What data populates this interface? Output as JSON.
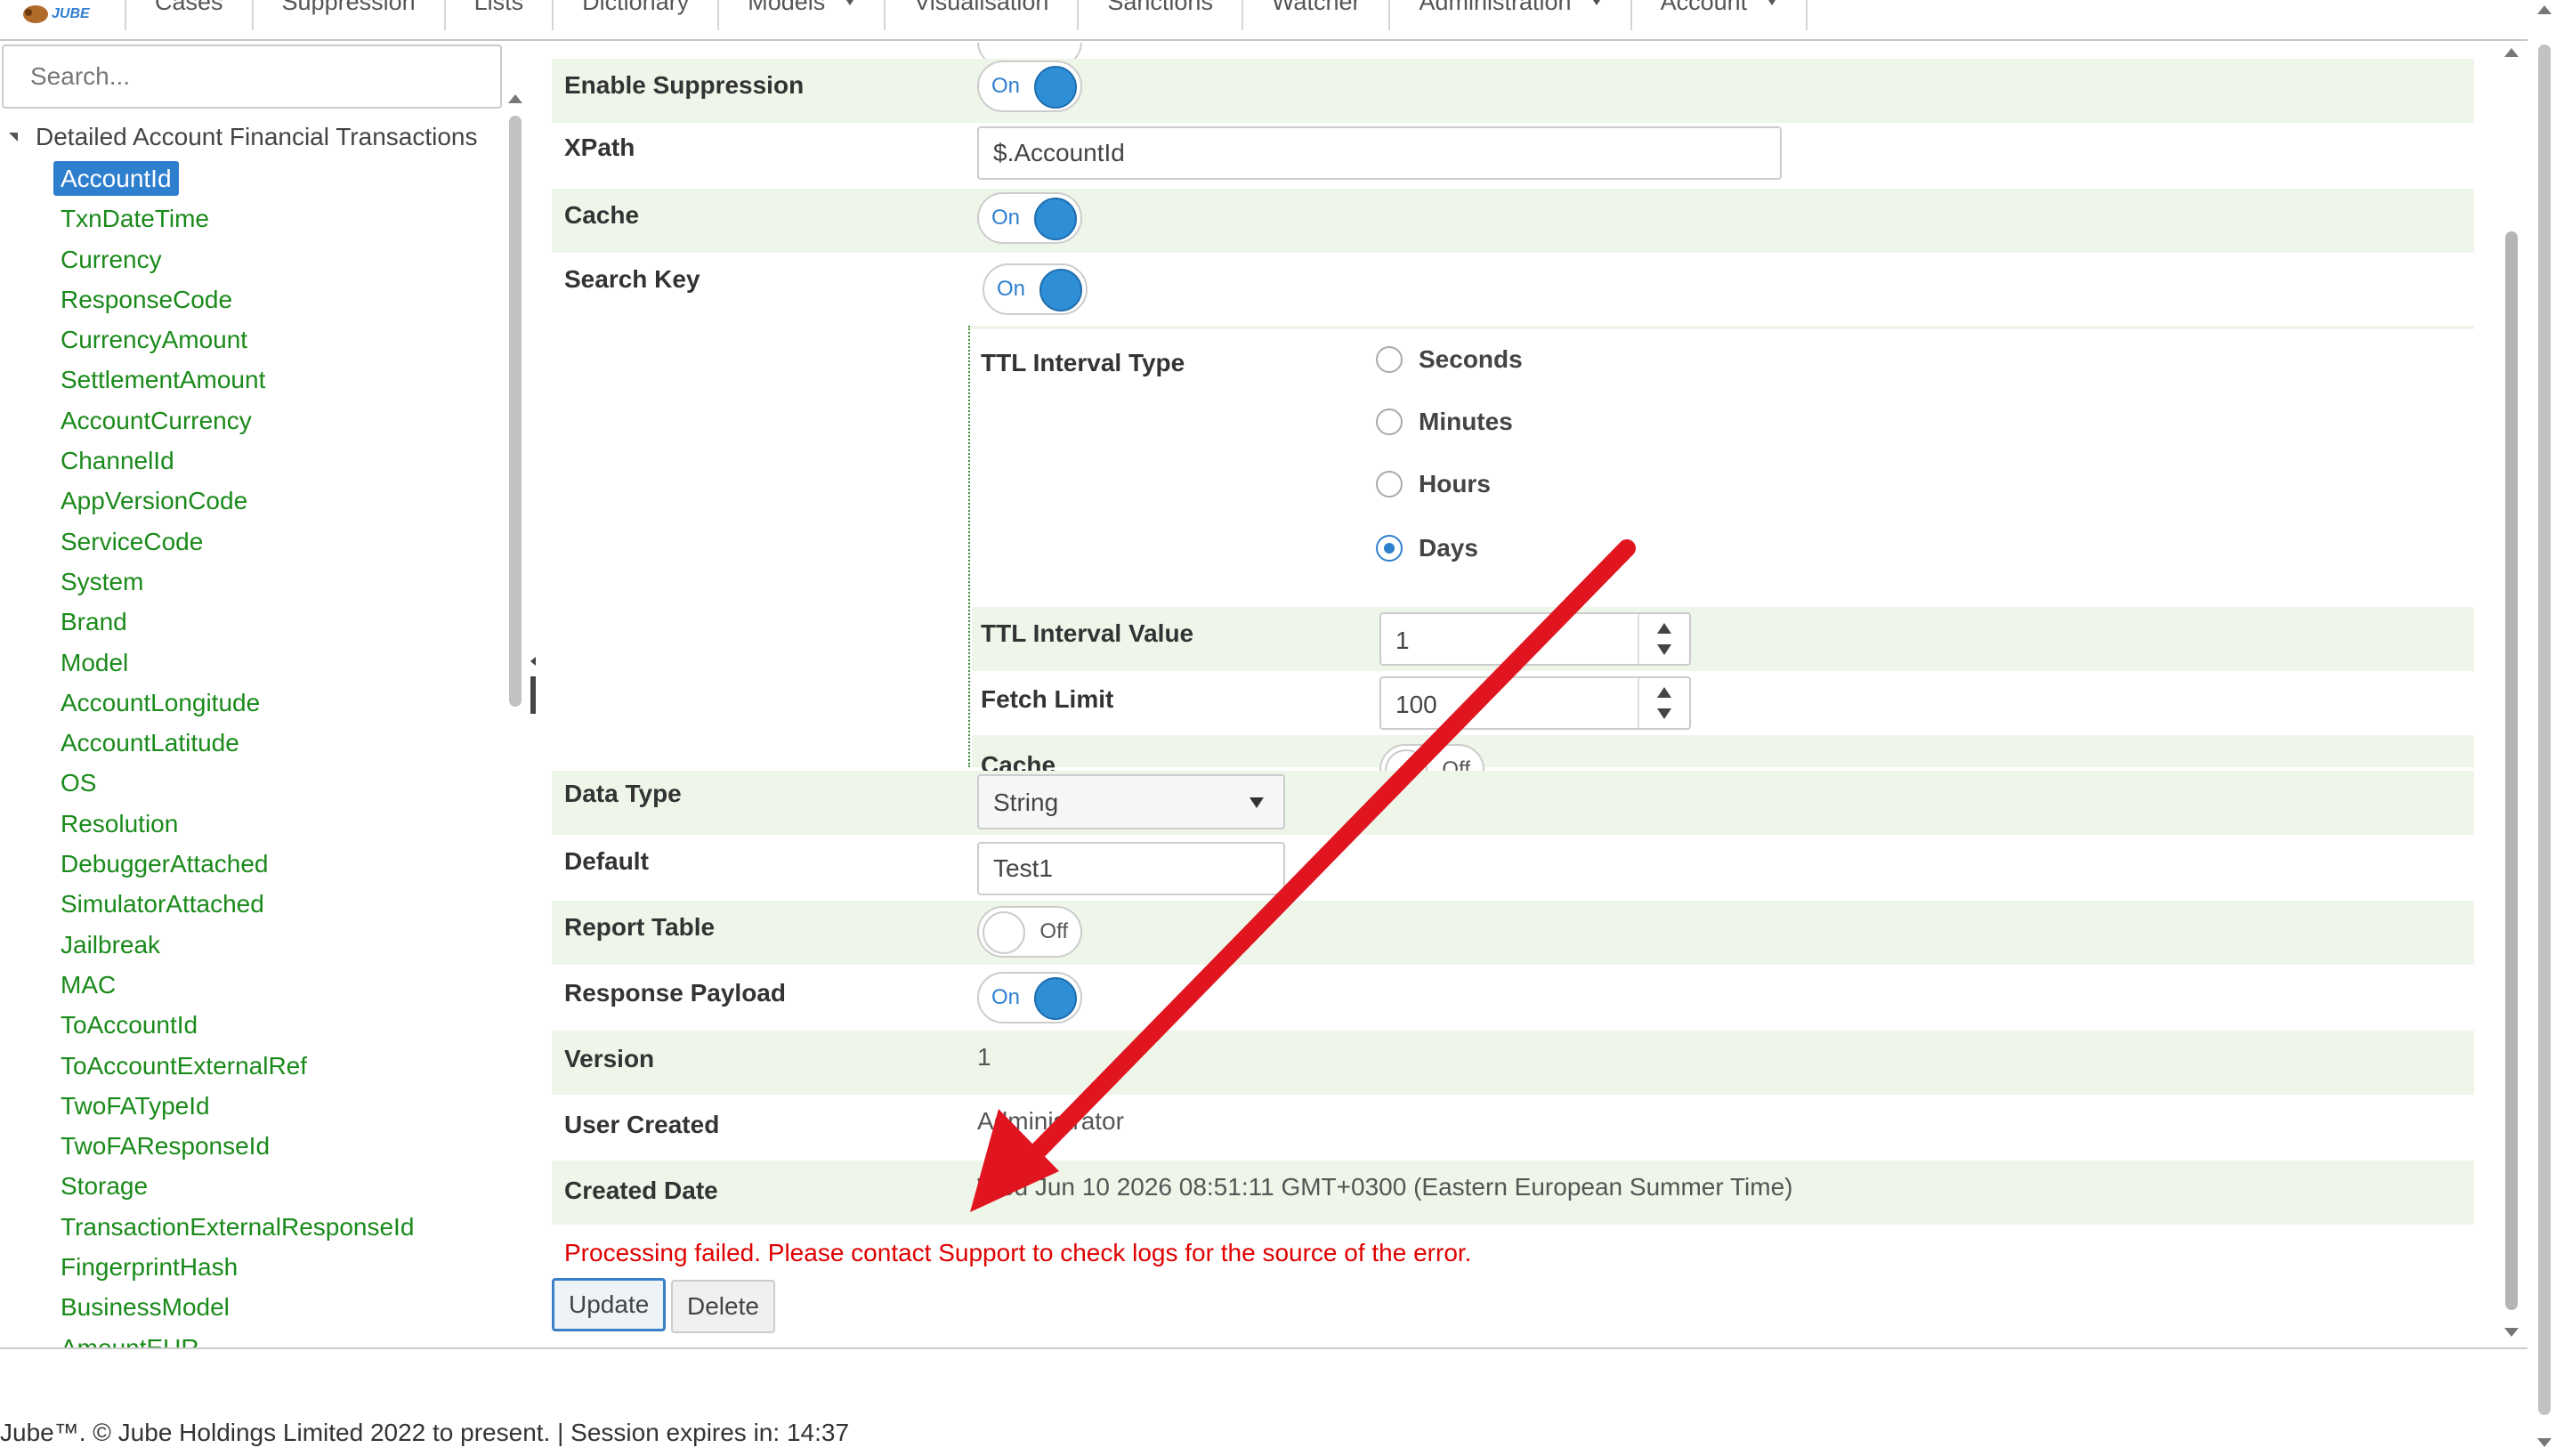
{
  "header": {
    "logo_text": "JUBE",
    "menu": [
      {
        "label": "Cases",
        "dropdown": false
      },
      {
        "label": "Suppression",
        "dropdown": false
      },
      {
        "label": "Lists",
        "dropdown": false
      },
      {
        "label": "Dictionary",
        "dropdown": false
      },
      {
        "label": "Models",
        "dropdown": true
      },
      {
        "label": "Visualisation",
        "dropdown": false
      },
      {
        "label": "Sanctions",
        "dropdown": false
      },
      {
        "label": "Watcher",
        "dropdown": false
      },
      {
        "label": "Administration",
        "dropdown": true
      },
      {
        "label": "Account",
        "dropdown": true
      }
    ]
  },
  "sidebar": {
    "search_placeholder": "Search...",
    "root": "Detailed Account Financial Transactions",
    "items": [
      "AccountId",
      "TxnDateTime",
      "Currency",
      "ResponseCode",
      "CurrencyAmount",
      "SettlementAmount",
      "AccountCurrency",
      "ChannelId",
      "AppVersionCode",
      "ServiceCode",
      "System",
      "Brand",
      "Model",
      "AccountLongitude",
      "AccountLatitude",
      "OS",
      "Resolution",
      "DebuggerAttached",
      "SimulatorAttached",
      "Jailbreak",
      "MAC",
      "ToAccountId",
      "ToAccountExternalRef",
      "TwoFATypeId",
      "TwoFAResponseId",
      "Storage",
      "TransactionExternalResponseId",
      "FingerprintHash",
      "BusinessModel",
      "AmountEUR"
    ],
    "selected": "AccountId"
  },
  "form": {
    "enable_suppression": {
      "label": "Enable Suppression",
      "state": "On"
    },
    "xpath": {
      "label": "XPath",
      "value": "$.AccountId"
    },
    "cache": {
      "label": "Cache",
      "state": "On"
    },
    "search_key": {
      "label": "Search Key",
      "state": "On"
    },
    "ttl_interval_type": {
      "label": "TTL Interval Type",
      "options": [
        "Seconds",
        "Minutes",
        "Hours",
        "Days"
      ],
      "selected": "Days"
    },
    "ttl_interval_value": {
      "label": "TTL Interval Value",
      "value": "1"
    },
    "fetch_limit": {
      "label": "Fetch Limit",
      "value": "100"
    },
    "search_cache": {
      "label": "Cache",
      "state": "Off"
    },
    "data_type": {
      "label": "Data Type",
      "value": "String"
    },
    "default": {
      "label": "Default",
      "value": "Test1"
    },
    "report_table": {
      "label": "Report Table",
      "state": "Off"
    },
    "response_payload": {
      "label": "Response Payload",
      "state": "On"
    },
    "version": {
      "label": "Version",
      "value": "1"
    },
    "user_created": {
      "label": "User Created",
      "value": "Administrator"
    },
    "created_date": {
      "label": "Created Date",
      "value": "Wed Jun 10 2026 08:51:11 GMT+0300 (Eastern European Summer Time)"
    }
  },
  "error_message": "Processing failed. Please contact Support to check logs for the source of the error.",
  "buttons": {
    "update": "Update",
    "delete": "Delete"
  },
  "footer": "Jube™. © Jube Holdings Limited 2022 to present.  |  Session expires in: 14:37",
  "colors": {
    "accent": "#2f7fcf",
    "tree_text": "#1a8a1a",
    "error": "#e00000",
    "row_shade": "#eef6e9",
    "annotation_arrow": "#e0151f"
  }
}
